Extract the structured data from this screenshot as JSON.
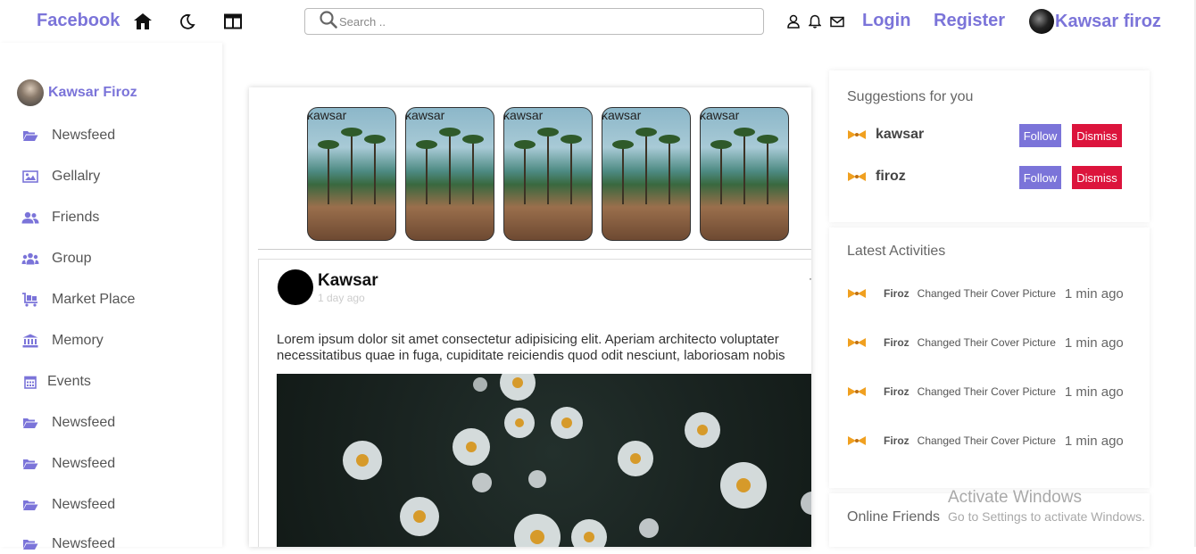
{
  "header": {
    "brand": "Facebook",
    "search_placeholder": "Search ..",
    "login": "Login",
    "register": "Register",
    "user_name": "Kawsar firoz",
    "icons": [
      "home-icon",
      "moon-icon",
      "layout-icon",
      "search-icon",
      "user-icon",
      "bell-icon",
      "mail-icon"
    ]
  },
  "sidebar": {
    "user_name": "Kawsar Firoz",
    "items": [
      {
        "label": "Newsfeed",
        "icon": "folder-open-icon"
      },
      {
        "label": "Gellalry",
        "icon": "image-icon"
      },
      {
        "label": "Friends",
        "icon": "users-icon"
      },
      {
        "label": "Group",
        "icon": "group-icon"
      },
      {
        "label": "Market Place",
        "icon": "cart-icon"
      },
      {
        "label": "Memory",
        "icon": "bank-icon"
      },
      {
        "label": "Events",
        "icon": "calendar-icon"
      },
      {
        "label": "Newsfeed",
        "icon": "folder-open-icon"
      },
      {
        "label": "Newsfeed",
        "icon": "folder-open-icon"
      },
      {
        "label": "Newsfeed",
        "icon": "folder-open-icon"
      },
      {
        "label": "Newsfeed",
        "icon": "folder-open-icon"
      }
    ]
  },
  "stories": [
    {
      "label": "kawsar"
    },
    {
      "label": "kawsar"
    },
    {
      "label": "kawsar"
    },
    {
      "label": "kawsar"
    },
    {
      "label": "kawsar"
    }
  ],
  "post": {
    "author": "Kawsar",
    "time": "1 day ago",
    "text_line1": "Lorem ipsum dolor sit amet consectetur adipisicing elit. Aperiam architecto voluptater",
    "text_line2": "necessitatibus quae in fuga, cupiditate reiciendis quod odit nesciunt, laboriosam nobis"
  },
  "suggestions": {
    "title": "Suggestions for you",
    "follow_label": "Follow",
    "dismiss_label": "Dismiss",
    "items": [
      {
        "name": "kawsar"
      },
      {
        "name": "firoz"
      }
    ]
  },
  "activities": {
    "title": "Latest Activities",
    "items": [
      {
        "name": "Firoz",
        "text": "Changed Their Cover Picture",
        "time": "1 min ago"
      },
      {
        "name": "Firoz",
        "text": "Changed Their Cover Picture",
        "time": "1 min ago"
      },
      {
        "name": "Firoz",
        "text": "Changed Their Cover Picture",
        "time": "1 min ago"
      },
      {
        "name": "Firoz",
        "text": "Changed Their Cover Picture",
        "time": "1 min ago"
      }
    ]
  },
  "online_friends": {
    "title": "Online Friends"
  },
  "watermark": {
    "line1": "Activate Windows",
    "line2": "Go to Settings to activate Windows."
  },
  "colors": {
    "accent": "#7b74d9",
    "danger": "#dc143c"
  }
}
